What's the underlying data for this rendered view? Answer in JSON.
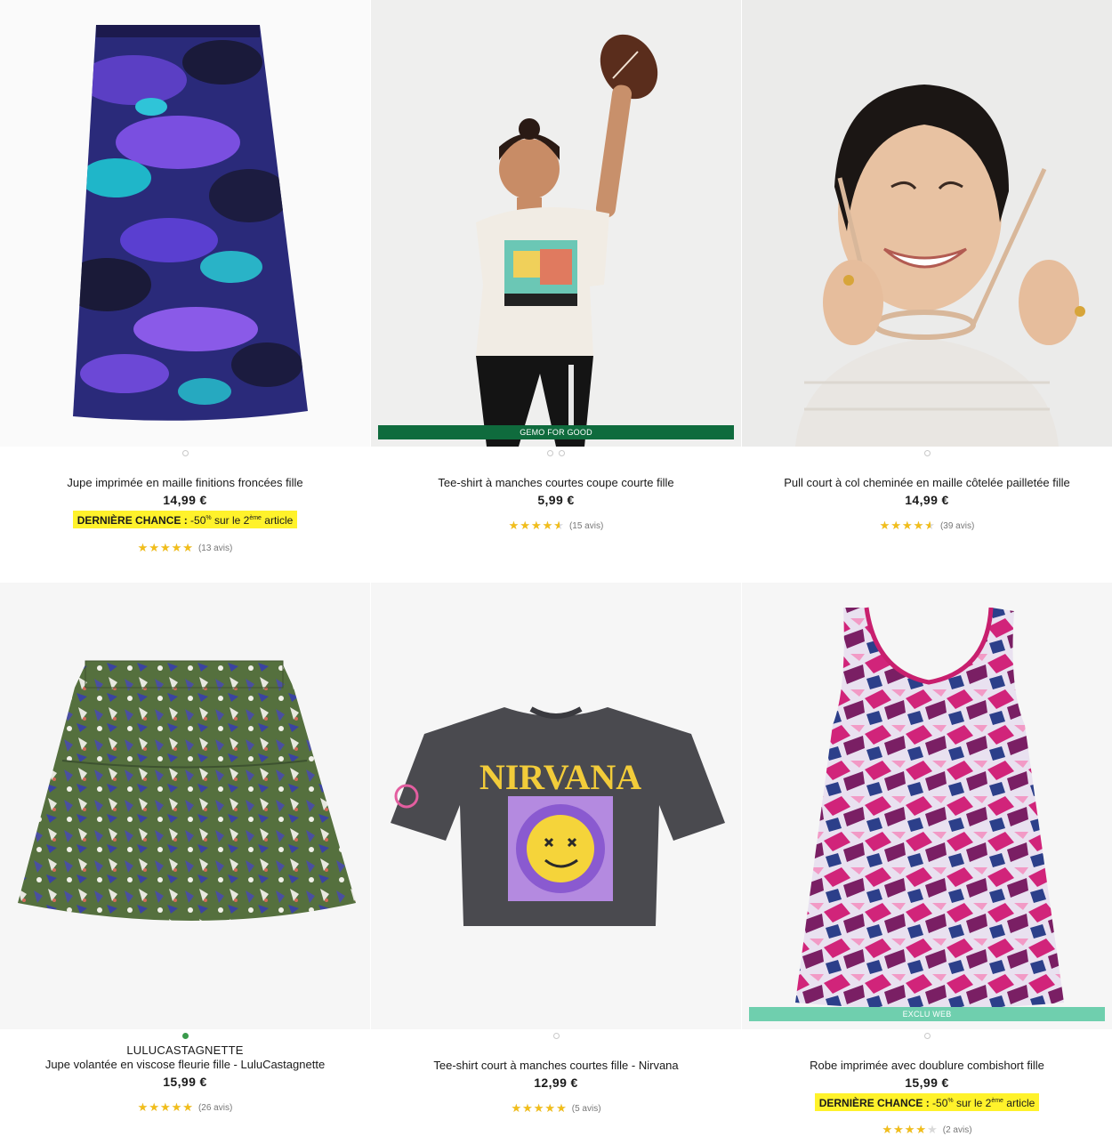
{
  "products": [
    {
      "title": "Jupe imprimée en maille finitions froncées fille",
      "price": "14,99 €",
      "promo": {
        "strong": "DERNIÈRE CHANCE :",
        "text1": " -50",
        "pct": "%",
        "text2": " sur le 2",
        "sup": "ème",
        "text3": " article"
      },
      "rating": 5,
      "reviews": "(13 avis)",
      "image": "purple-print-midi-skirt"
    },
    {
      "title": "Tee-shirt à manches courtes coupe courte fille",
      "price": "5,99 €",
      "badge": "GEMO FOR GOOD",
      "rating": 4.5,
      "reviews": "(15 avis)",
      "image": "girl-white-tee-football"
    },
    {
      "title": "Pull court à col cheminée en maille côtelée pailletée fille",
      "price": "14,99 €",
      "rating": 4.5,
      "reviews": "(39 avis)",
      "image": "girl-glasses-white-sweater"
    },
    {
      "brand": "LULUCASTAGNETTE",
      "title": "Jupe volantée en viscose fleurie fille - LuluCastagnette",
      "price": "15,99 €",
      "rating": 5,
      "reviews": "(26 avis)",
      "image": "floral-tiered-skirt"
    },
    {
      "title": "Tee-shirt court à manches courtes fille - Nirvana",
      "price": "12,99 €",
      "rating": 5,
      "reviews": "(5 avis)",
      "image": "nirvana-crop-tee",
      "print": "NIRVANA"
    },
    {
      "title": "Robe imprimée avec doublure combishort fille",
      "price": "15,99 €",
      "badge": "EXCLU WEB",
      "promo": {
        "strong": "DERNIÈRE CHANCE :",
        "text1": " -50",
        "pct": "%",
        "text2": " sur le 2",
        "sup": "ème",
        "text3": " article"
      },
      "rating": 4,
      "reviews": "(2 avis)",
      "image": "pink-print-romper-dress"
    }
  ],
  "colors": {
    "gemo_green": "#0f6b3d",
    "exclu_mint": "#6fcfae",
    "promo_yellow": "#fff22b",
    "star": "#f2be1a"
  }
}
